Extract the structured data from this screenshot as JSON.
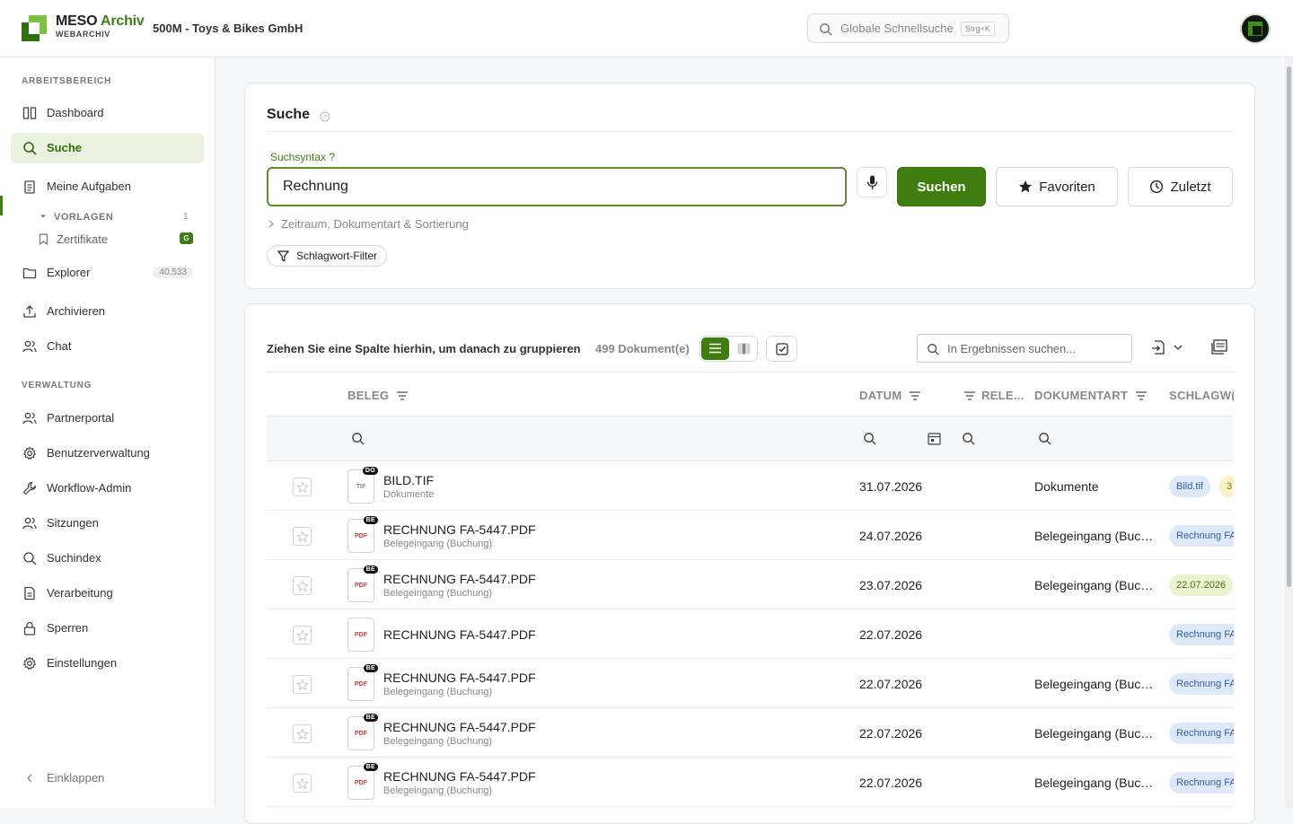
{
  "brand": {
    "name_part1": "MESO",
    "name_part2": "Archiv",
    "sub": "WEBARCHIV",
    "tenant": "500M - Toys & Bikes GmbH",
    "accent": "#3f7d16"
  },
  "global_search": {
    "placeholder": "Globale Schnellsuche",
    "shortcut": "Strg+K"
  },
  "sidebar": {
    "section_work": "ARBEITSBEREICH",
    "dashboard": "Dashboard",
    "search": "Suche",
    "tasks": "Meine Aufgaben",
    "templates_label": "VORLAGEN",
    "templates_count": "1",
    "certificates": "Zertifikate",
    "certificates_badge": "G",
    "explorer": "Explorer",
    "explorer_count": "40.533",
    "archive": "Archivieren",
    "chat": "Chat",
    "section_admin": "VERWALTUNG",
    "partner": "Partnerportal",
    "users": "Benutzerverwaltung",
    "workflow": "Workflow-Admin",
    "sessions": "Sitzungen",
    "index": "Suchindex",
    "processing": "Verarbeitung",
    "locks": "Sperren",
    "settings": "Einstellungen",
    "collapse": "Einklappen"
  },
  "search_panel": {
    "title": "Suche",
    "syntax_label": "Suchsyntax ?",
    "query": "Rechnung",
    "search_button": "Suchen",
    "favorites_button": "Favoriten",
    "recent_button": "Zuletzt",
    "expander": "Zeitraum, Dokumentart & Sortierung",
    "keyword_filter": "Schlagwort-Filter"
  },
  "results": {
    "group_hint": "Ziehen Sie eine Spalte hierhin, um danach zu gruppieren",
    "doc_count": "499 Dokument(e)",
    "search_placeholder": "In Ergebnissen suchen...",
    "columns": {
      "beleg": "BELEG",
      "datum": "DATUM",
      "relevanz": "RELE...",
      "dokumentart": "DOKUMENTART",
      "schlagworte": "SCHLAGW("
    },
    "rows": [
      {
        "name": "BILD.TIF",
        "sub": "Dokumente",
        "type": "TIF",
        "tag": "DO",
        "date": "31.07.2026",
        "doctype": "Dokumente",
        "pill": "Bild.tif",
        "pill2": "3"
      },
      {
        "name": "RECHNUNG FA-5447.PDF",
        "sub": "Belegeingang (Buchung)",
        "type": "PDF",
        "tag": "BE",
        "date": "24.07.2026",
        "doctype": "Belegeingang (Buc…",
        "pill": "Rechnung FA"
      },
      {
        "name": "RECHNUNG FA-5447.PDF",
        "sub": "Belegeingang (Buchung)",
        "type": "PDF",
        "tag": "BE",
        "date": "23.07.2026",
        "doctype": "Belegeingang (Buc…",
        "pill": "22.07.2026"
      },
      {
        "name": "RECHNUNG FA-5447.PDF",
        "sub": "",
        "type": "PDF",
        "tag": "",
        "date": "22.07.2026",
        "doctype": "",
        "pill": "Rechnung FA"
      },
      {
        "name": "RECHNUNG FA-5447.PDF",
        "sub": "Belegeingang (Buchung)",
        "type": "PDF",
        "tag": "BE",
        "date": "22.07.2026",
        "doctype": "Belegeingang (Buc…",
        "pill": "Rechnung FA"
      },
      {
        "name": "RECHNUNG FA-5447.PDF",
        "sub": "Belegeingang (Buchung)",
        "type": "PDF",
        "tag": "BE",
        "date": "22.07.2026",
        "doctype": "Belegeingang (Buc…",
        "pill": "Rechnung FA"
      },
      {
        "name": "RECHNUNG FA-5447.PDF",
        "sub": "Belegeingang (Buchung)",
        "type": "PDF",
        "tag": "BE",
        "date": "22.07.2026",
        "doctype": "Belegeingang (Buc…",
        "pill": "Rechnung FA"
      }
    ]
  }
}
